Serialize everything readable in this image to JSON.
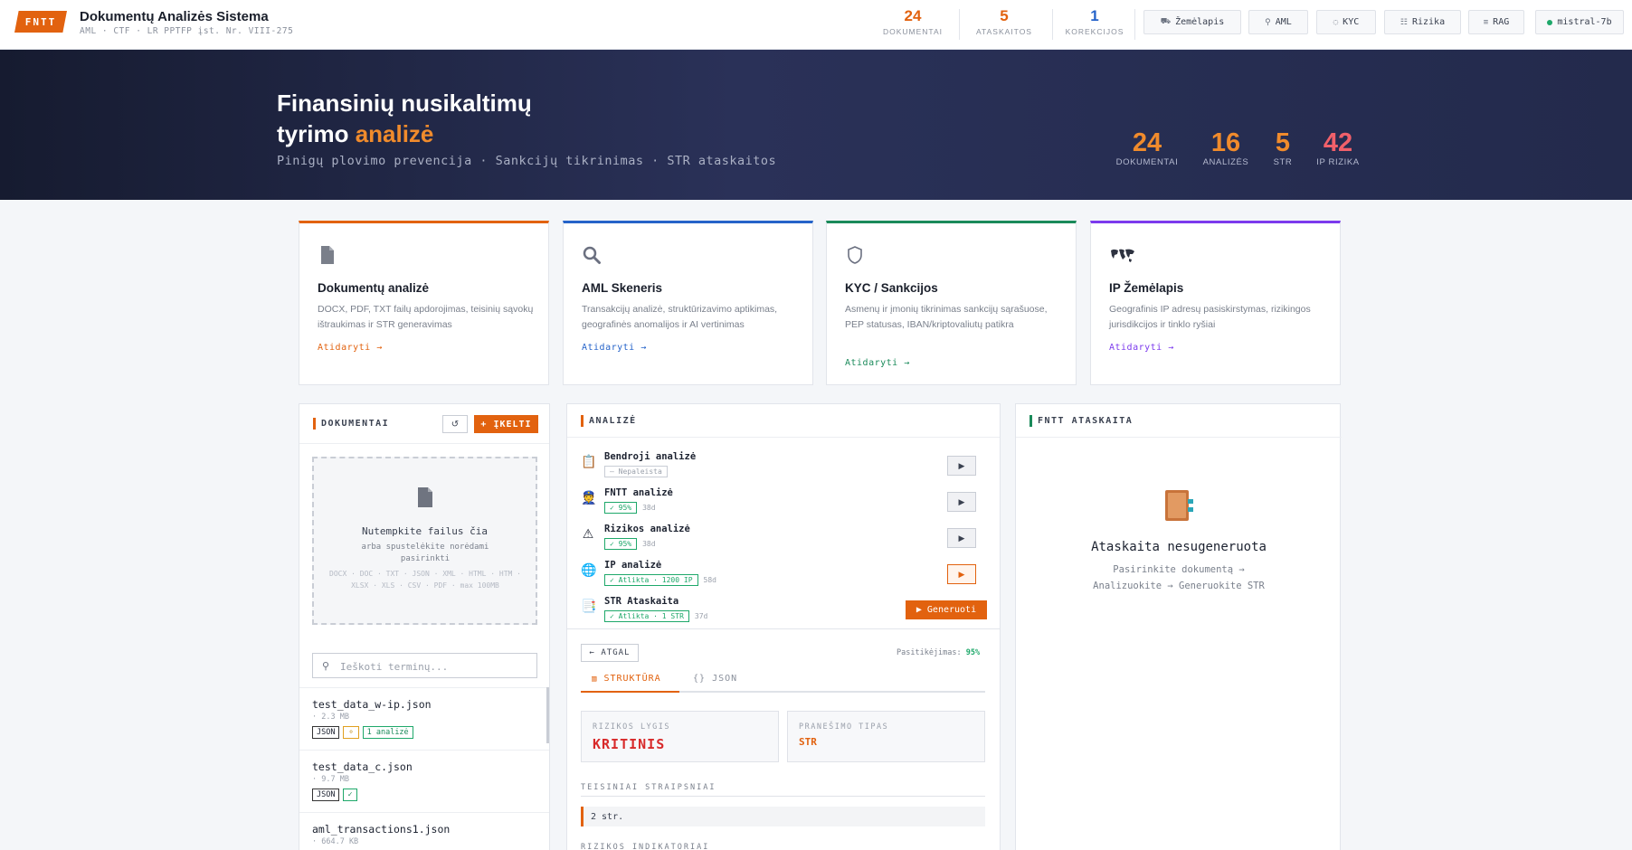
{
  "header": {
    "logo": "FNTT",
    "title": "Dokumentų Analizės Sistema",
    "subtitle": "AML · CTF · LR PPTFP įst. Nr. VIII-275",
    "stats": [
      {
        "value": "24",
        "label": "DOKUMENTAI",
        "color": "#e2620f"
      },
      {
        "value": "5",
        "label": "ATASKAITOS",
        "color": "#e2620f"
      },
      {
        "value": "1",
        "label": "KOREKCIJOS",
        "color": "#2563c9"
      }
    ],
    "nav": [
      {
        "icon": "map-icon",
        "glyph": "⛟",
        "label": "Žemėlapis"
      },
      {
        "icon": "search-icon",
        "glyph": "⚲",
        "label": "AML"
      },
      {
        "icon": "shield-icon",
        "glyph": "◌",
        "label": "KYC"
      },
      {
        "icon": "risk-icon",
        "glyph": "☷",
        "label": "Rizika"
      },
      {
        "icon": "db-icon",
        "glyph": "≡",
        "label": "RAG"
      },
      {
        "icon": "status-dot",
        "glyph": "",
        "label": "mistral-7b"
      }
    ]
  },
  "hero": {
    "title_line1": "Finansinių nusikaltimų",
    "title_line2": "tyrimo ",
    "title_accent": "analizė",
    "subtitle": "Pinigų plovimo prevencija · Sankcijų tikrinimas · STR ataskaitos",
    "stats": [
      {
        "value": "24",
        "label": "DOKUMENTAI",
        "color": "#f08b2c"
      },
      {
        "value": "16",
        "label": "ANALIZĖS",
        "color": "#f08b2c"
      },
      {
        "value": "5",
        "label": "STR",
        "color": "#f08b2c"
      },
      {
        "value": "42",
        "label": "IP RIZIKA",
        "color": "#f0606a"
      }
    ]
  },
  "features": [
    {
      "title": "Dokumentų analizė",
      "desc": "DOCX, PDF, TXT failų apdorojimas, teisinių sąvokų ištraukimas ir STR generavimas",
      "link": "Atidaryti →",
      "color": "#e2620f"
    },
    {
      "title": "AML Skeneris",
      "desc": "Transakcijų analizė, struktūrizavimo aptikimas, geografinės anomalijos ir AI vertinimas",
      "link": "Atidaryti →",
      "color": "#2563c9"
    },
    {
      "title": "KYC / Sankcijos",
      "desc": "Asmenų ir įmonių tikrinimas sankcijų sąrašuose, PEP statusas, IBAN/kriptovaliutų patikra",
      "link": "Atidaryti →",
      "color": "#1a8a5a"
    },
    {
      "title": "IP Žemėlapis",
      "desc": "Geografinis IP adresų pasiskirstymas, rizikingos jurisdikcijos ir tinklo ryšiai",
      "link": "Atidaryti →",
      "color": "#7c3aed"
    }
  ],
  "documents": {
    "title": "DOKUMENTAI",
    "refresh": "↺",
    "upload": "+ ĮKELTI",
    "drop_title": "Nutempkite failus čia",
    "drop_sub": "arba spustelėkite norėdami pasirinkti",
    "drop_formats": "DOCX · DOC · TXT · JSON · XML · HTML · HTM · XLSX · XLS · CSV · PDF · max 100MB",
    "search_placeholder": "Ieškoti terminų...",
    "files": [
      {
        "name": "test_data_w-ip.json",
        "size": "· 2.3 MB",
        "tags": [
          "JSON",
          "⚬",
          "1 analizė"
        ]
      },
      {
        "name": "test_data_c.json",
        "size": "· 9.7 MB",
        "tags": [
          "JSON",
          "✓"
        ]
      },
      {
        "name": "aml_transactions1.json",
        "size": "· 664.7 KB",
        "tags": []
      }
    ]
  },
  "analysis": {
    "title": "ANALIZĖ",
    "rows": [
      {
        "icon": "clipboard-icon",
        "glyph": "📋",
        "name": "Bendroji analizė",
        "status": "— Nepaleista",
        "ok": false,
        "date": "",
        "action": "▶"
      },
      {
        "icon": "police-icon",
        "glyph": "👮",
        "name": "FNTT analizė",
        "status": "✓ 95%",
        "ok": true,
        "date": "38d",
        "action": "▶"
      },
      {
        "icon": "warning-icon",
        "glyph": "⚠",
        "name": "Rizikos analizė",
        "status": "✓ 95%",
        "ok": true,
        "date": "38d",
        "action": "▶"
      },
      {
        "icon": "globe-icon",
        "glyph": "🌐",
        "name": "IP analizė",
        "status": "✓ Atlikta · 1200 IP",
        "ok": true,
        "date": "58d",
        "action": "▶"
      },
      {
        "icon": "report-icon",
        "glyph": "📑",
        "name": "STR Ataskaita",
        "status": "✓ Atlikta · 1 STR",
        "ok": true,
        "date": "37d",
        "action": "▶ Generuoti"
      }
    ],
    "back": "← ATGAL",
    "confidence_label": "Pasitikėjimas:",
    "confidence_value": "95%",
    "tab_structure": "STRUKTŪRA",
    "tab_json": "JSON",
    "risk_level_label": "RIZIKOS LYGIS",
    "risk_level_value": "KRITINIS",
    "report_type_label": "PRANEŠIMO TIPAS",
    "report_type_value": "STR",
    "legal_label": "TEISINIAI STRAIPSNIAI",
    "legal_value": "2 str.",
    "indicators_label": "RIZIKOS INDIKATORIAI"
  },
  "report": {
    "title": "FNTT ATASKAITA",
    "empty_title": "Ataskaita nesugeneruota",
    "empty_line1": "Pasirinkite dokumentą →",
    "empty_line2": "Analizuokite → Generuokite STR"
  }
}
